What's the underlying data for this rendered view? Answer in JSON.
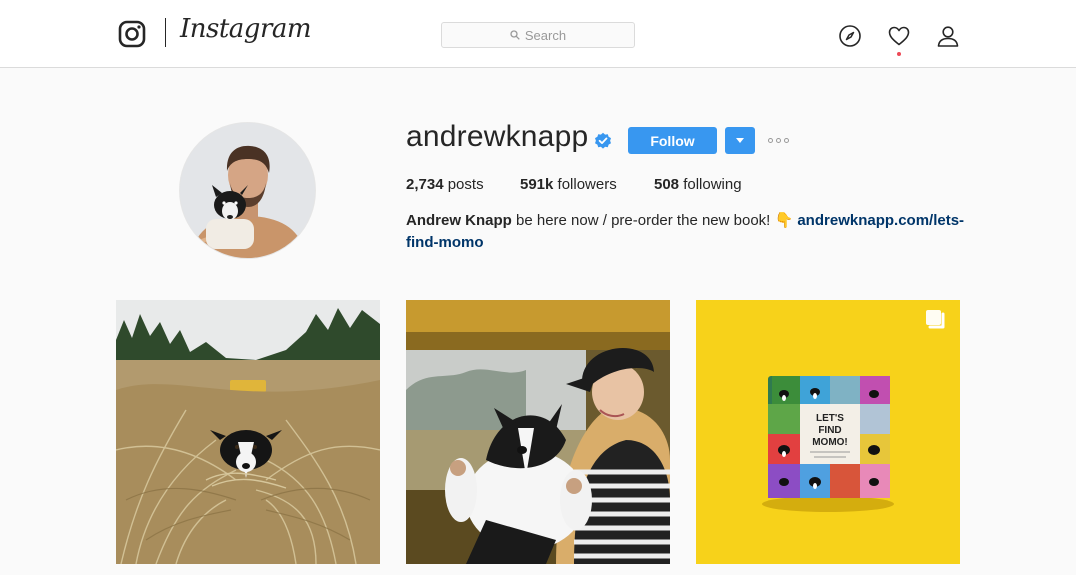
{
  "nav": {
    "brand": "Instagram",
    "search_placeholder": "Search"
  },
  "profile": {
    "username": "andrewknapp",
    "verified": true,
    "follow_label": "Follow",
    "stats": {
      "posts_count": "2,734",
      "posts_label": " posts",
      "followers_count": "591k",
      "followers_label": " followers",
      "following_count": "508",
      "following_label": " following"
    },
    "bio": {
      "name": "Andrew Knapp",
      "text": " be here now / pre-order the new book! 👇 ",
      "link": "andrewknapp.com/lets-find-momo"
    }
  },
  "posts": [
    {
      "description": "Border collie in tall dune grass",
      "multiple": false
    },
    {
      "description": "Woman in black cap holding border collie in van",
      "multiple": false
    },
    {
      "description": "Let's Find Momo book on yellow background",
      "multiple": true
    }
  ],
  "book": {
    "title_line1": "LET'S",
    "title_line2": "FIND",
    "title_line3": "MOMO!"
  },
  "colors": {
    "accent": "#3897f0",
    "verified": "#3897f0",
    "link": "#003569",
    "notification_dot": "#ed4956",
    "post3_bg": "#f7d21a"
  }
}
